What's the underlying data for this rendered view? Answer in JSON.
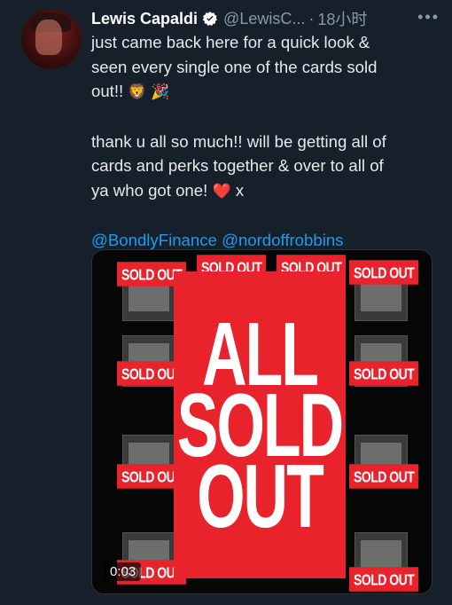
{
  "tweet": {
    "author_name": "Lewis Capaldi",
    "handle": "@LewisC...",
    "separator": "·",
    "time": "18小时",
    "more_glyph": "•••",
    "line1": "just came back here for a quick look &",
    "line2": "seen every single one of the cards sold",
    "line3": "out!!",
    "line3_emoji": "🦁 🎉",
    "line4": "thank u all so much!! will be getting all of",
    "line5": "cards and perks together & over to all of",
    "line6": "ya who got one!",
    "line6_heart": "❤️",
    "line6_end": "x",
    "mention1": "@BondlyFinance",
    "mention2": "@nordoffrobbins"
  },
  "media": {
    "small_badge": "SOLD OUT",
    "small_badge_partial": "SOLD OU",
    "small_badge_top": "SOLD OUT",
    "big_line1": "ALL",
    "big_line2": "SOLD",
    "big_line3": "OUT",
    "timer": "0:03"
  },
  "colors": {
    "background": "#15202b",
    "link": "#1d9bf0",
    "sold_out_red": "#e8232b",
    "muted": "#8b98a5"
  }
}
